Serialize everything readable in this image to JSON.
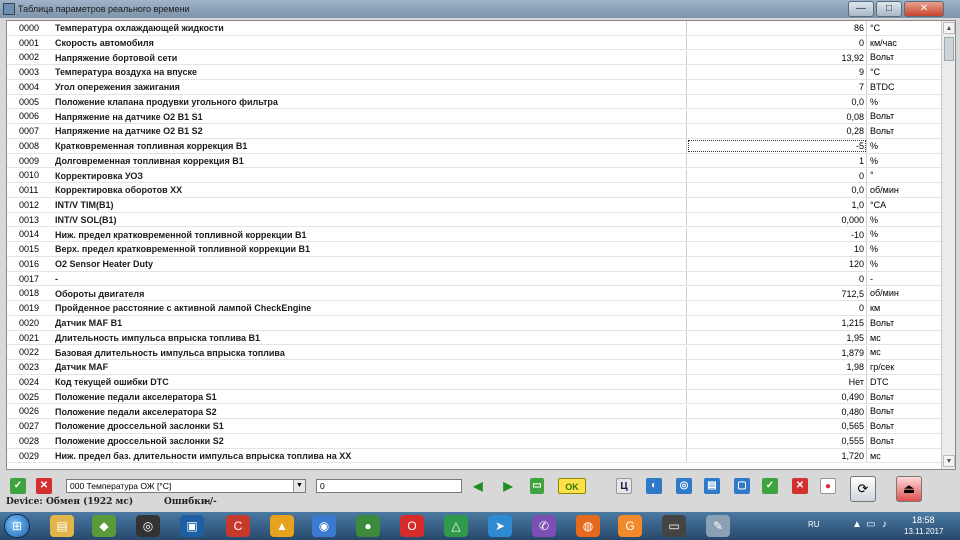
{
  "window": {
    "title": "Таблица параметров реального времени",
    "min": "—",
    "max": "□",
    "close": "✕"
  },
  "rows": [
    {
      "code": "0000",
      "name": "Температура охлаждающей жидкости",
      "value": "86",
      "unit": "°C"
    },
    {
      "code": "0001",
      "name": "Скорость автомобиля",
      "value": "0",
      "unit": "км/час"
    },
    {
      "code": "0002",
      "name": "Напряжение бортовой сети",
      "value": "13,92",
      "unit": "Вольт"
    },
    {
      "code": "0003",
      "name": "Температура воздуха на впуске",
      "value": "9",
      "unit": "°C"
    },
    {
      "code": "0004",
      "name": "Угол опережения зажигания",
      "value": "7",
      "unit": "BTDC"
    },
    {
      "code": "0005",
      "name": "Положение клапана продувки угольного фильтра",
      "value": "0,0",
      "unit": "%"
    },
    {
      "code": "0006",
      "name": "Напряжение на датчике O2 B1 S1",
      "value": "0,08",
      "unit": "Вольт"
    },
    {
      "code": "0007",
      "name": "Напряжение на датчике O2 B1 S2",
      "value": "0,28",
      "unit": "Вольт"
    },
    {
      "code": "0008",
      "name": "Кратковременная топливная коррекция B1",
      "value": "-5",
      "unit": "%"
    },
    {
      "code": "0009",
      "name": "Долговременная топливная коррекция B1",
      "value": "1",
      "unit": "%"
    },
    {
      "code": "0010",
      "name": "Корректировка УОЗ",
      "value": "0",
      "unit": "°"
    },
    {
      "code": "0011",
      "name": "Корректировка оборотов ХХ",
      "value": "0,0",
      "unit": "об/мин"
    },
    {
      "code": "0012",
      "name": "INT/V TIM(B1)",
      "value": "1,0",
      "unit": "°CA"
    },
    {
      "code": "0013",
      "name": "INT/V SOL(B1)",
      "value": "0,000",
      "unit": "%"
    },
    {
      "code": "0014",
      "name": "Ниж. предел кратковременной топливной коррекции B1",
      "value": "-10",
      "unit": "%"
    },
    {
      "code": "0015",
      "name": "Верх. предел кратковременной топливной коррекции B1",
      "value": "10",
      "unit": "%"
    },
    {
      "code": "0016",
      "name": "O2 Sensor Heater Duty",
      "value": "120",
      "unit": "%"
    },
    {
      "code": "0017",
      "name": "-",
      "value": "0",
      "unit": "-"
    },
    {
      "code": "0018",
      "name": "Обороты двигателя",
      "value": "712,5",
      "unit": "об/мин"
    },
    {
      "code": "0019",
      "name": "Пройденное расстояние с активной лампой CheckEngine",
      "value": "0",
      "unit": "км"
    },
    {
      "code": "0020",
      "name": "Датчик MAF B1",
      "value": "1,215",
      "unit": "Вольт"
    },
    {
      "code": "0021",
      "name": "Длительность импульса впрыска топлива B1",
      "value": "1,95",
      "unit": "мс"
    },
    {
      "code": "0022",
      "name": "Базовая длительность импульса впрыска топлива",
      "value": "1,879",
      "unit": "мс"
    },
    {
      "code": "0023",
      "name": "Датчик MAF",
      "value": "1,98",
      "unit": "гр/сек"
    },
    {
      "code": "0024",
      "name": "Код текущей ошибки DTC",
      "value": "Нет",
      "unit": "DTC"
    },
    {
      "code": "0025",
      "name": "Положение педали акселератора S1",
      "value": "0,490",
      "unit": "Вольт"
    },
    {
      "code": "0026",
      "name": "Положение педали акселератора S2",
      "value": "0,480",
      "unit": "Вольт"
    },
    {
      "code": "0027",
      "name": "Положение дроссельной заслонки S1",
      "value": "0,565",
      "unit": "Вольт"
    },
    {
      "code": "0028",
      "name": "Положение дроссельной заслонки S2",
      "value": "0,555",
      "unit": "Вольт"
    },
    {
      "code": "0029",
      "name": "Ниж. предел баз. длительности импульса впрыска топлива на ХХ",
      "value": "1,720",
      "unit": "мс"
    }
  ],
  "selected_row": 8,
  "toolbar": {
    "param_select": "000 Температура ОЖ [°C]",
    "value_input": "0",
    "ok_label": "OK",
    "c_label": "Ц"
  },
  "status": {
    "device_label": "Device:",
    "device_value": "Обмен (1922 мс)",
    "errors_label": "Ошибки:",
    "errors_value": "-/-"
  },
  "taskbar": {
    "lang": "RU",
    "time": "18:58",
    "date": "13.11.2017"
  },
  "colors": {
    "accent_green": "#3fa33f",
    "accent_red": "#d43030",
    "taskbar": "#27486b"
  }
}
